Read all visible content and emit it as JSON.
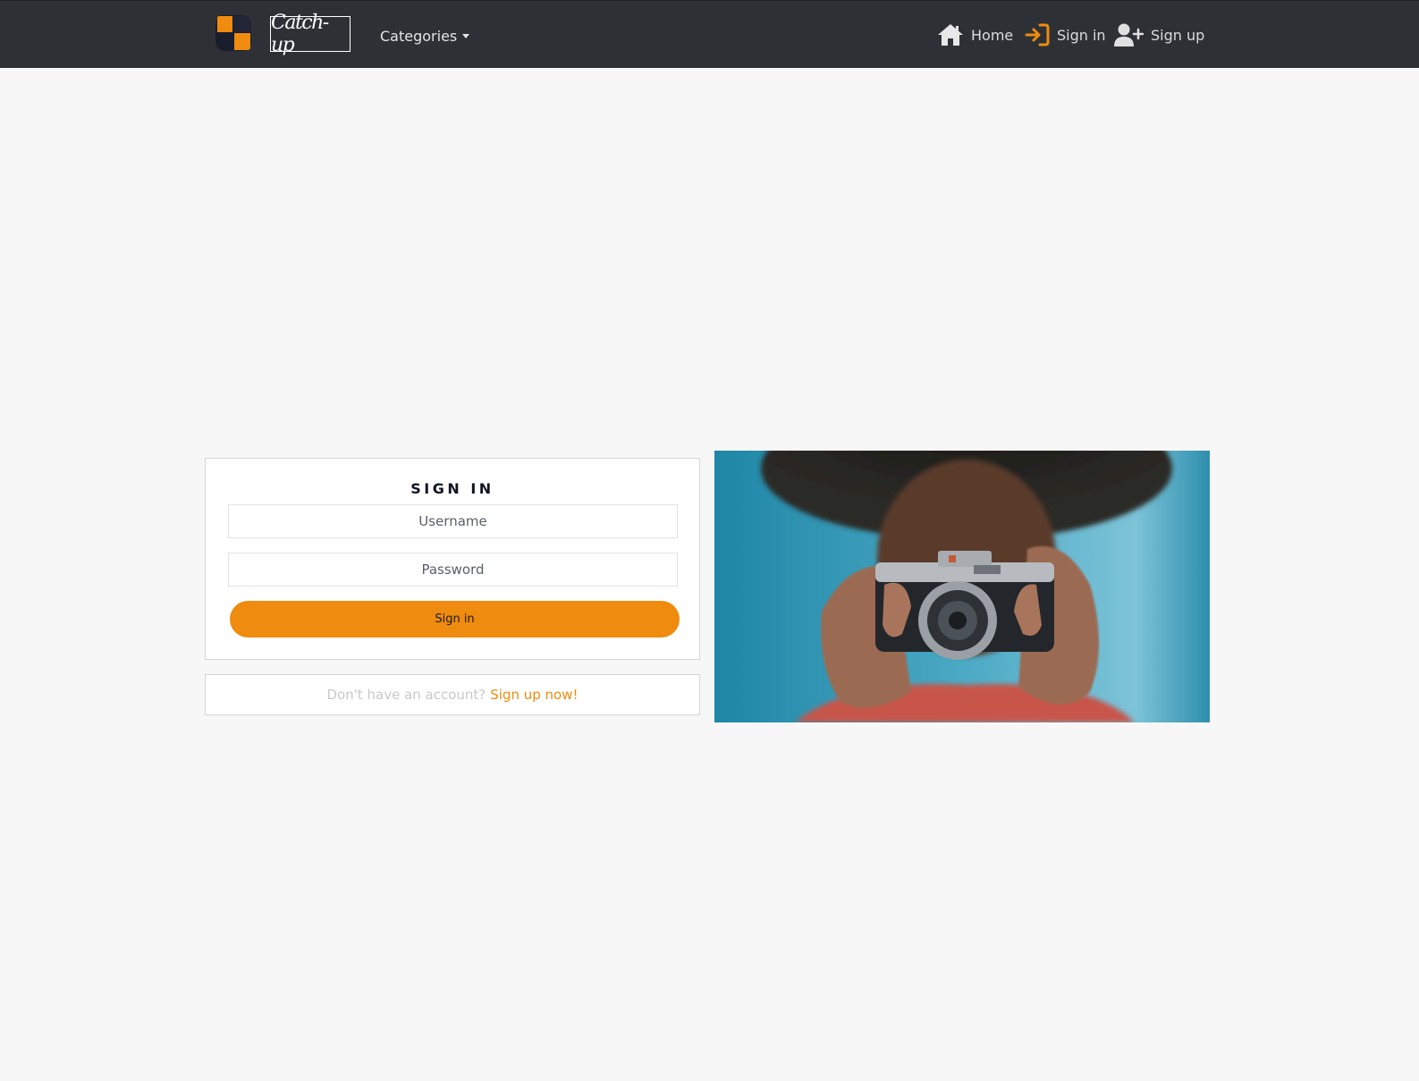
{
  "navbar": {
    "brand_text": "Catch-up",
    "categories_label": "Categories",
    "links": {
      "home": "Home",
      "signin": "Sign in",
      "signup": "Sign up"
    }
  },
  "signin_form": {
    "title": "SIGN IN",
    "username_placeholder": "Username",
    "password_placeholder": "Password",
    "submit_label": "Sign in"
  },
  "signup_prompt": {
    "text": "Don't have an account?",
    "link_text": "Sign up now!"
  },
  "icons": {
    "brand_logo": "orange-navy-squares-logo",
    "home": "house-icon",
    "signin": "sign-in-arrow-icon",
    "signup": "user-plus-icon",
    "categories": "caret-down-icon"
  },
  "colors": {
    "navbar_bg": "#2d3135",
    "accent": "#ef8b0e",
    "page_bg": "#f7f7f7",
    "title_text": "#111426"
  }
}
